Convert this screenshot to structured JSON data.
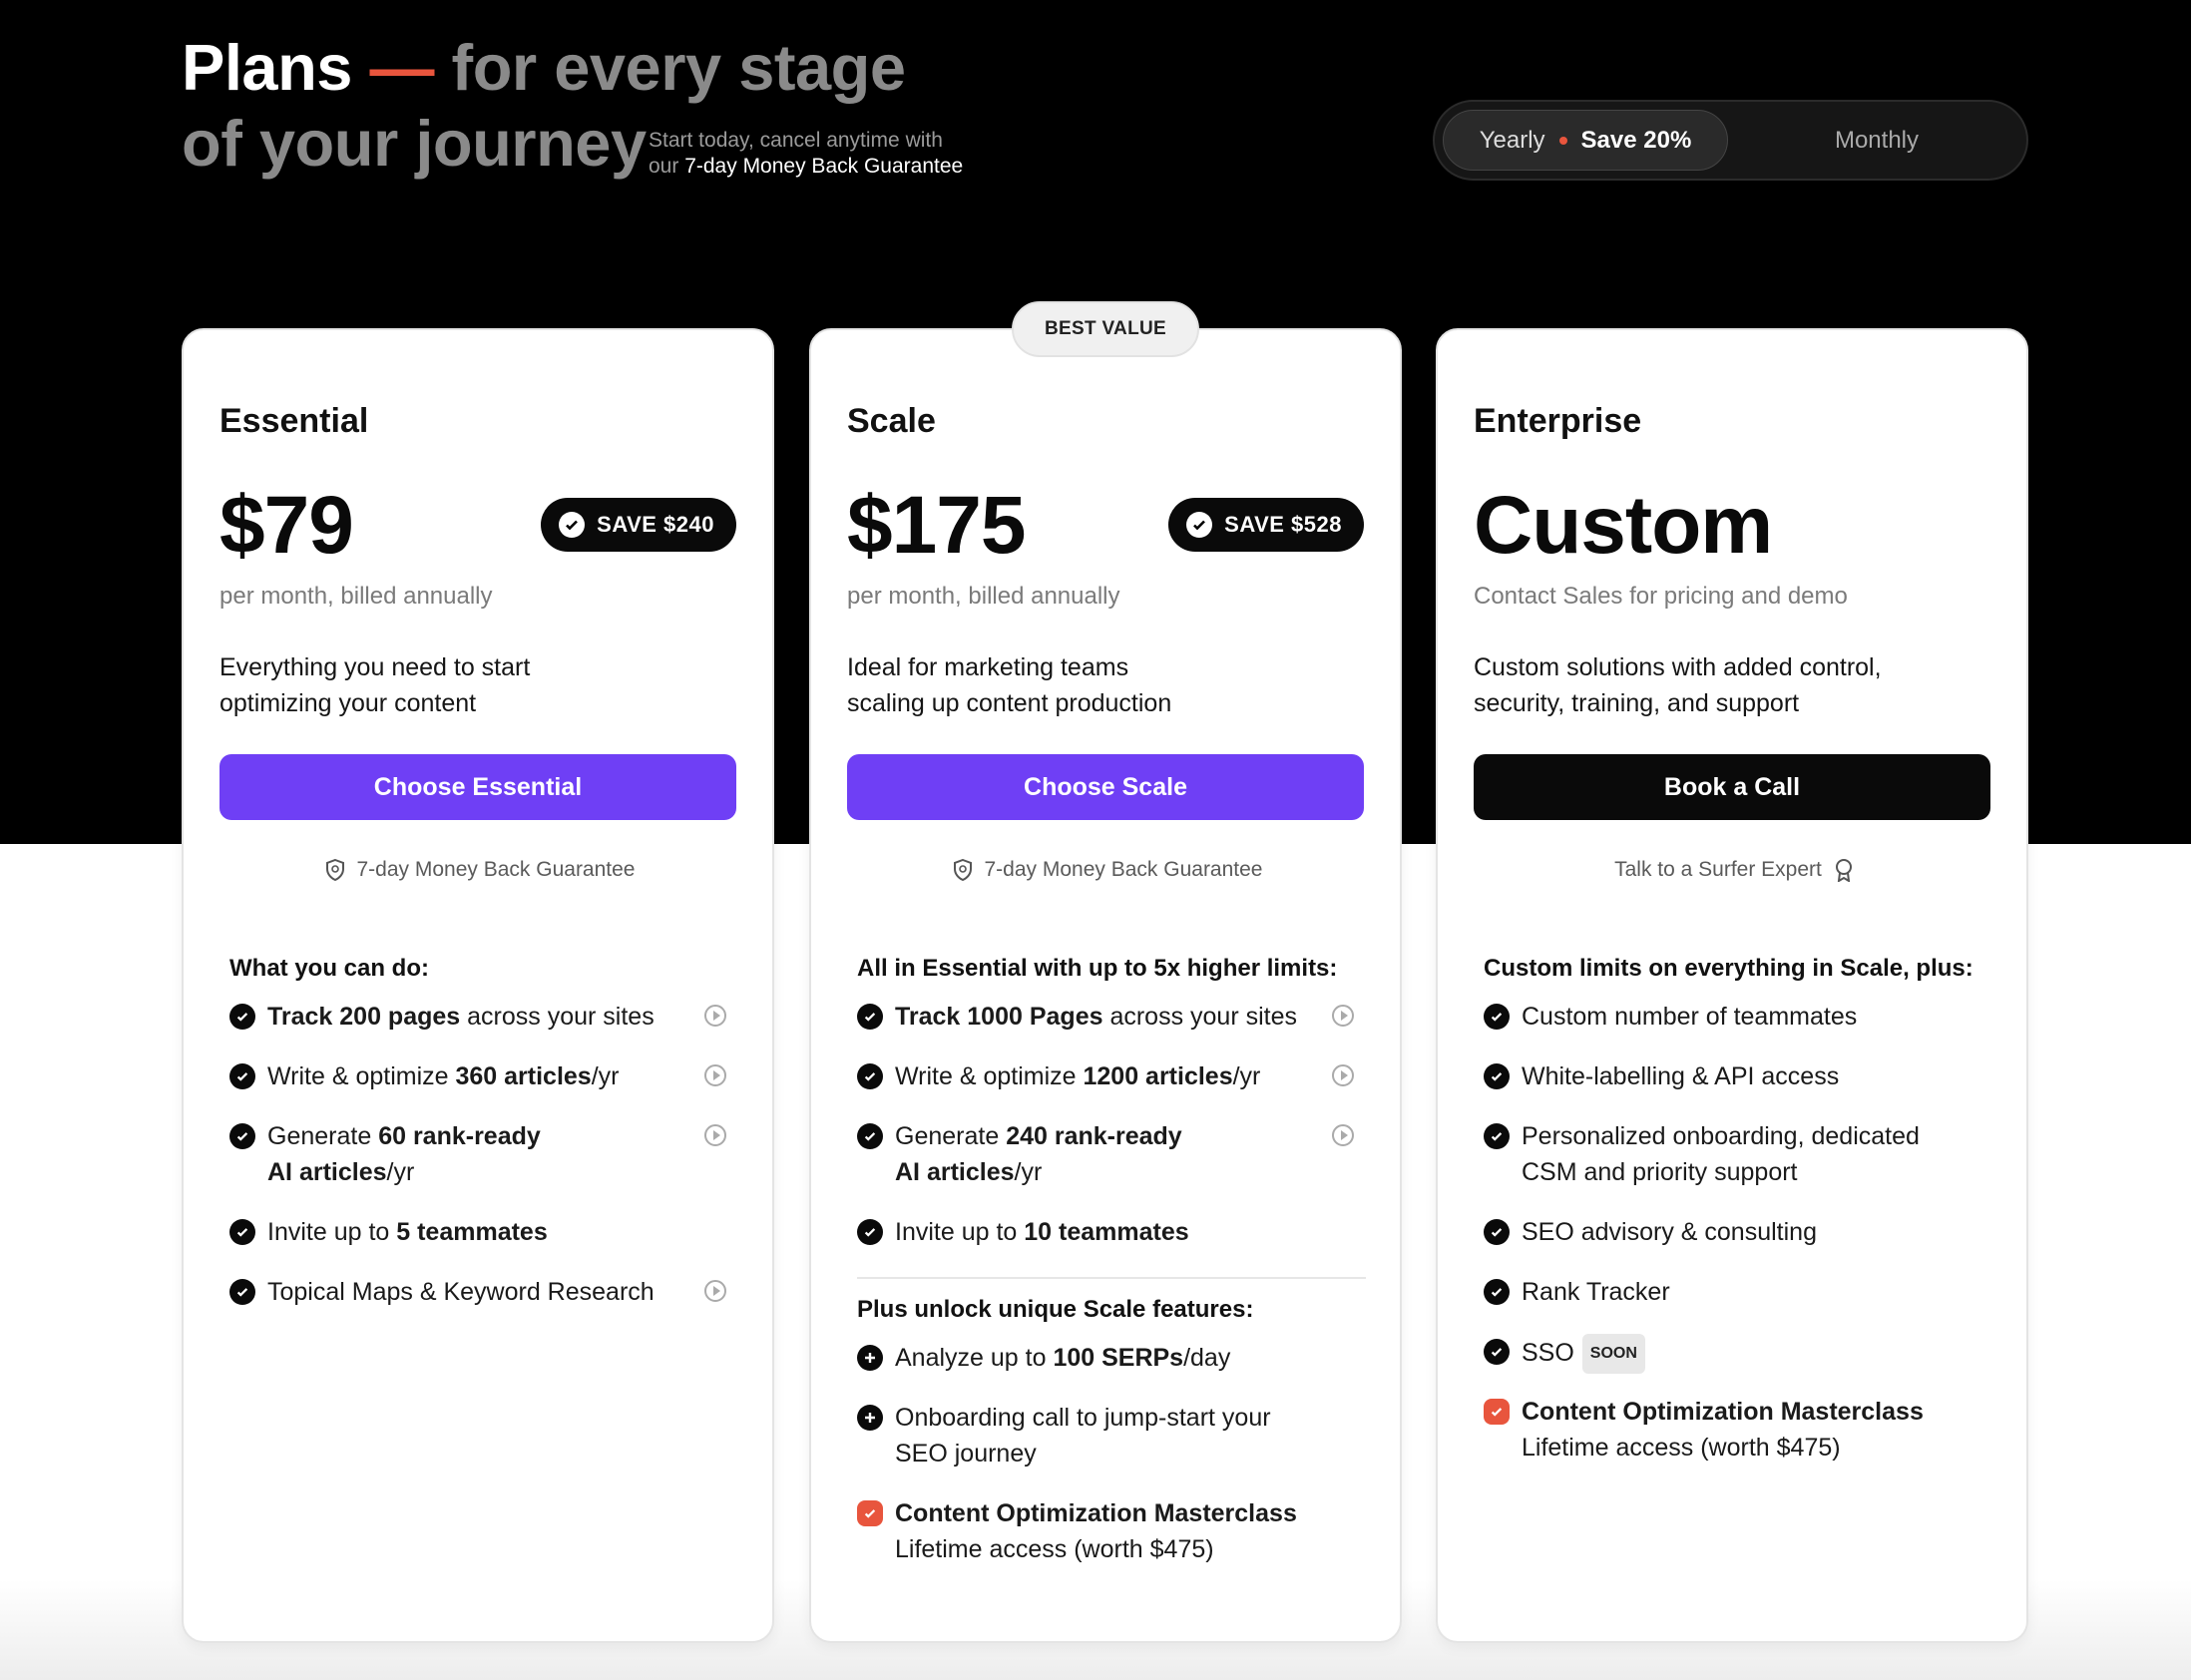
{
  "hero": {
    "title_plans": "Plans",
    "title_dash": "—",
    "title_rest1": "for every stage",
    "title_rest2": "of your journey",
    "sub_line1": "Start today, cancel anytime with",
    "sub_our": "our",
    "sub_guarantee": "7-day Money Back Guarantee"
  },
  "toggle": {
    "yearly": "Yearly",
    "save": "Save 20%",
    "monthly": "Monthly"
  },
  "best_value_badge": "BEST VALUE",
  "plans": [
    {
      "name": "Essential",
      "price": "$79",
      "save_badge": "SAVE $240",
      "billing": "per month, billed annually",
      "desc1": "Everything you need to start",
      "desc2": "optimizing your content",
      "cta": "Choose Essential",
      "guarantee": "7-day Money Back Guarantee",
      "features_title": "What you can do:",
      "features": [
        {
          "pre": "",
          "bold": "Track 200 pages",
          "post": " across your sites"
        },
        {
          "pre": "Write & optimize ",
          "bold": "360 articles",
          "post": "/yr"
        },
        {
          "pre": "Generate ",
          "bold": "60 rank-ready",
          "line2_bold": "AI articles",
          "line2_post": "/yr"
        },
        {
          "pre": "Invite up to ",
          "bold": "5 teammates",
          "post": ""
        },
        {
          "pre": "Topical Maps & Keyword Research",
          "bold": "",
          "post": ""
        }
      ]
    },
    {
      "name": "Scale",
      "price": "$175",
      "save_badge": "SAVE $528",
      "billing": "per month, billed annually",
      "desc1": "Ideal for marketing teams",
      "desc2": "scaling up content production",
      "cta": "Choose Scale",
      "guarantee": "7-day Money Back Guarantee",
      "features_title": "All in Essential with up to 5x higher limits:",
      "features": [
        {
          "pre": "",
          "bold": "Track 1000 Pages",
          "post": " across your sites"
        },
        {
          "pre": "Write & optimize ",
          "bold": "1200 articles",
          "post": "/yr"
        },
        {
          "pre": "Generate ",
          "bold": "240 rank-ready",
          "line2_bold": "AI articles",
          "line2_post": "/yr"
        },
        {
          "pre": "Invite up to ",
          "bold": "10 teammates",
          "post": ""
        }
      ],
      "unlock_title": "Plus unlock unique Scale features:",
      "unlock": [
        {
          "pre": "Analyze up to ",
          "bold": "100 SERPs",
          "post": "/day"
        },
        {
          "line1": "Onboarding call to jump-start your",
          "line2": "SEO journey"
        },
        {
          "bold": "Content Optimization Masterclass",
          "line2": "Lifetime access (worth $475)"
        }
      ]
    },
    {
      "name": "Enterprise",
      "price": "Custom",
      "billing": "Contact Sales for pricing and demo",
      "desc1": "Custom solutions with added control,",
      "desc2": "security, training, and support",
      "cta": "Book a Call",
      "talk": "Talk to a Surfer Expert",
      "features_title": "Custom limits on everything in Scale, plus:",
      "features": [
        {
          "text": "Custom number of teammates"
        },
        {
          "text": "White-labelling & API access"
        },
        {
          "line1": "Personalized onboarding, dedicated",
          "line2": "CSM and priority support"
        },
        {
          "text": "SEO advisory & consulting"
        },
        {
          "text": "Rank Tracker"
        },
        {
          "text": "SSO",
          "badge": "SOON"
        },
        {
          "bold": "Content Optimization Masterclass",
          "line2": "Lifetime access (worth $475)"
        }
      ]
    }
  ],
  "colors": {
    "accent": "#6f3ff5",
    "highlight": "#e8553d",
    "dark": "#0a0a0a"
  }
}
